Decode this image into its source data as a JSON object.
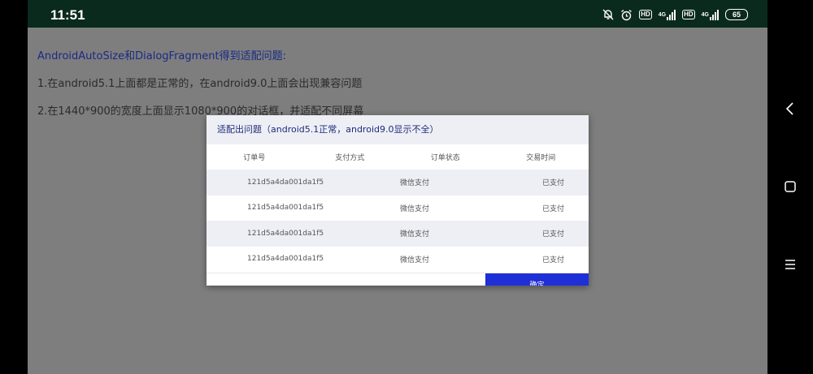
{
  "status_bar": {
    "time": "11:51",
    "hd1": "HD",
    "net1": "4G",
    "hd2": "HD",
    "net2": "4G",
    "battery": "65"
  },
  "content": {
    "line1": "AndroidAutoSize和DialogFragment得到适配问题:",
    "line2": "1.在android5.1上面都是正常的，在android9.0上面会出现兼容问题",
    "line3": "2.在1440*900的宽度上面显示1080*900的对话框，并适配不同屏幕"
  },
  "dialog": {
    "title": "适配出问题（android5.1正常，android9.0显示不全）",
    "headers": [
      "订单号",
      "支付方式",
      "订单状态",
      "交易时间"
    ],
    "rows": [
      {
        "order_id": "121d5a4da001da1f5",
        "payment": "微信支付",
        "status": "已支付"
      },
      {
        "order_id": "121d5a4da001da1f5",
        "payment": "微信支付",
        "status": "已支付"
      },
      {
        "order_id": "121d5a4da001da1f5",
        "payment": "微信支付",
        "status": "已支付"
      },
      {
        "order_id": "121d5a4da001da1f5",
        "payment": "微信支付",
        "status": "已支付"
      }
    ],
    "confirm_label": "确定"
  },
  "colors": {
    "status_bar_bg": "#0a2a1d",
    "dim_overlay": "#7e7e7e",
    "title_text": "#1e2a7a",
    "row_alt_bg": "#eeeff5",
    "confirm_bg": "#1f2fd8"
  },
  "icons": [
    "mute-bell-icon",
    "alarm-icon",
    "signal-icon",
    "battery-icon",
    "back-icon",
    "home-icon",
    "menu-icon"
  ]
}
